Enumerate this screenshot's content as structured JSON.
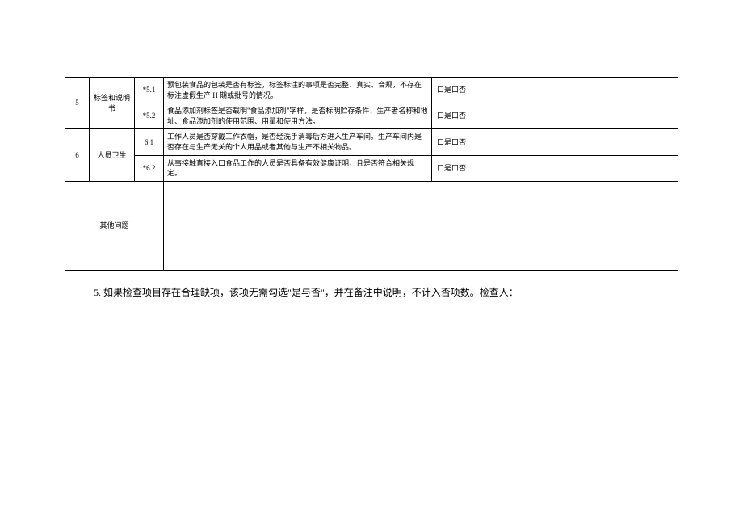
{
  "rows": {
    "r5": {
      "num": "5",
      "category": "标签和说明书",
      "items": {
        "a": {
          "code": "*5.1",
          "desc": "预包装食品的包装是否有标签，标签标注的事项是否完整、真实、合规，不存在标注虚假生产 H 期或批号的情况。",
          "check": "口是口否"
        },
        "b": {
          "code": "*5.2",
          "desc": "食品添加剂标签是否载明\"食品添加剂\"字样，是否标明贮存条件、生产者名称和地址、食品添加剂的使用范围、用量和使用方法。",
          "check": "口是口否"
        }
      }
    },
    "r6": {
      "num": "6",
      "category": "人员卫生",
      "items": {
        "a": {
          "code": "6.1",
          "desc": "工作人员是否穿戴工作衣帽，是否经洗手消毒后方进入生产车间。生产车间内是否存在与生产无关的个人用品或者其他与生产不相关物品。",
          "check": "口是口否"
        },
        "b": {
          "code": "*6.2",
          "desc": "从事接触直接入口食品工作的人员是否具备有效健康证明，且是否符合相关规定。",
          "check": "口是口否"
        }
      }
    },
    "other": {
      "label": "其他问题"
    }
  },
  "footnote": "5. 如果检查项目存在合理缺项，该项无需勾选\"是与否\"，并在备注中说明，不计入否项数。检查人："
}
